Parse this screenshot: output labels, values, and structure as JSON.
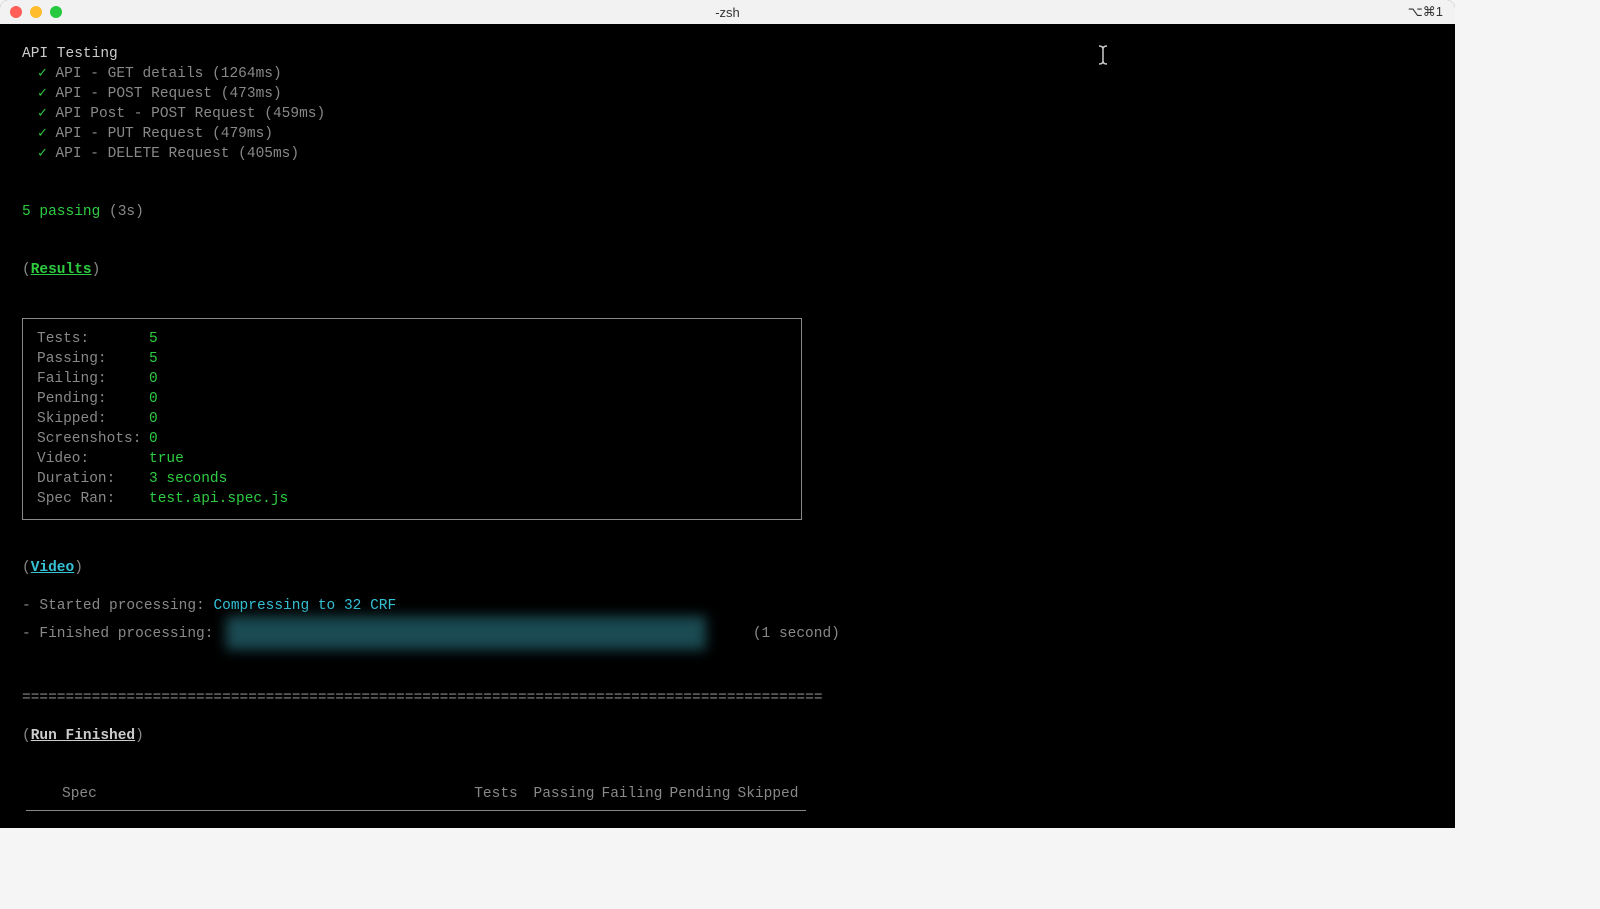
{
  "titlebar": {
    "title": "-zsh",
    "shortcut": "⌥⌘1"
  },
  "suite": {
    "title": "API Testing",
    "tests": [
      {
        "name": "API - GET details",
        "time": "(1264ms)"
      },
      {
        "name": "API - POST Request",
        "time": "(473ms)"
      },
      {
        "name": "API Post - POST Request",
        "time": "(459ms)"
      },
      {
        "name": "API - PUT Request",
        "time": "(479ms)"
      },
      {
        "name": "API - DELETE Request",
        "time": "(405ms)"
      }
    ]
  },
  "summary": {
    "passing_count": "5 passing",
    "passing_time": "(3s)"
  },
  "results": {
    "header": "Results",
    "rows": [
      {
        "label": "Tests:",
        "value": "5"
      },
      {
        "label": "Passing:",
        "value": "5"
      },
      {
        "label": "Failing:",
        "value": "0"
      },
      {
        "label": "Pending:",
        "value": "0"
      },
      {
        "label": "Skipped:",
        "value": "0"
      },
      {
        "label": "Screenshots:",
        "value": "0"
      },
      {
        "label": "Video:",
        "value": "true"
      },
      {
        "label": "Duration:",
        "value": "3 seconds"
      },
      {
        "label": "Spec Ran:",
        "value": "test.api.spec.js"
      }
    ]
  },
  "video": {
    "header": "Video",
    "started_label": "Started processing:",
    "started_value": "Compressing to 32 CRF",
    "finished_label": "Finished processing:",
    "finished_duration": "(1 second)"
  },
  "divider": "====================================================================================================",
  "run_finished": {
    "header": "Run Finished",
    "columns": {
      "spec": "Spec",
      "tests": "Tests",
      "passing": "Passing",
      "failing": "Failing",
      "pending": "Pending",
      "skipped": "Skipped"
    }
  }
}
